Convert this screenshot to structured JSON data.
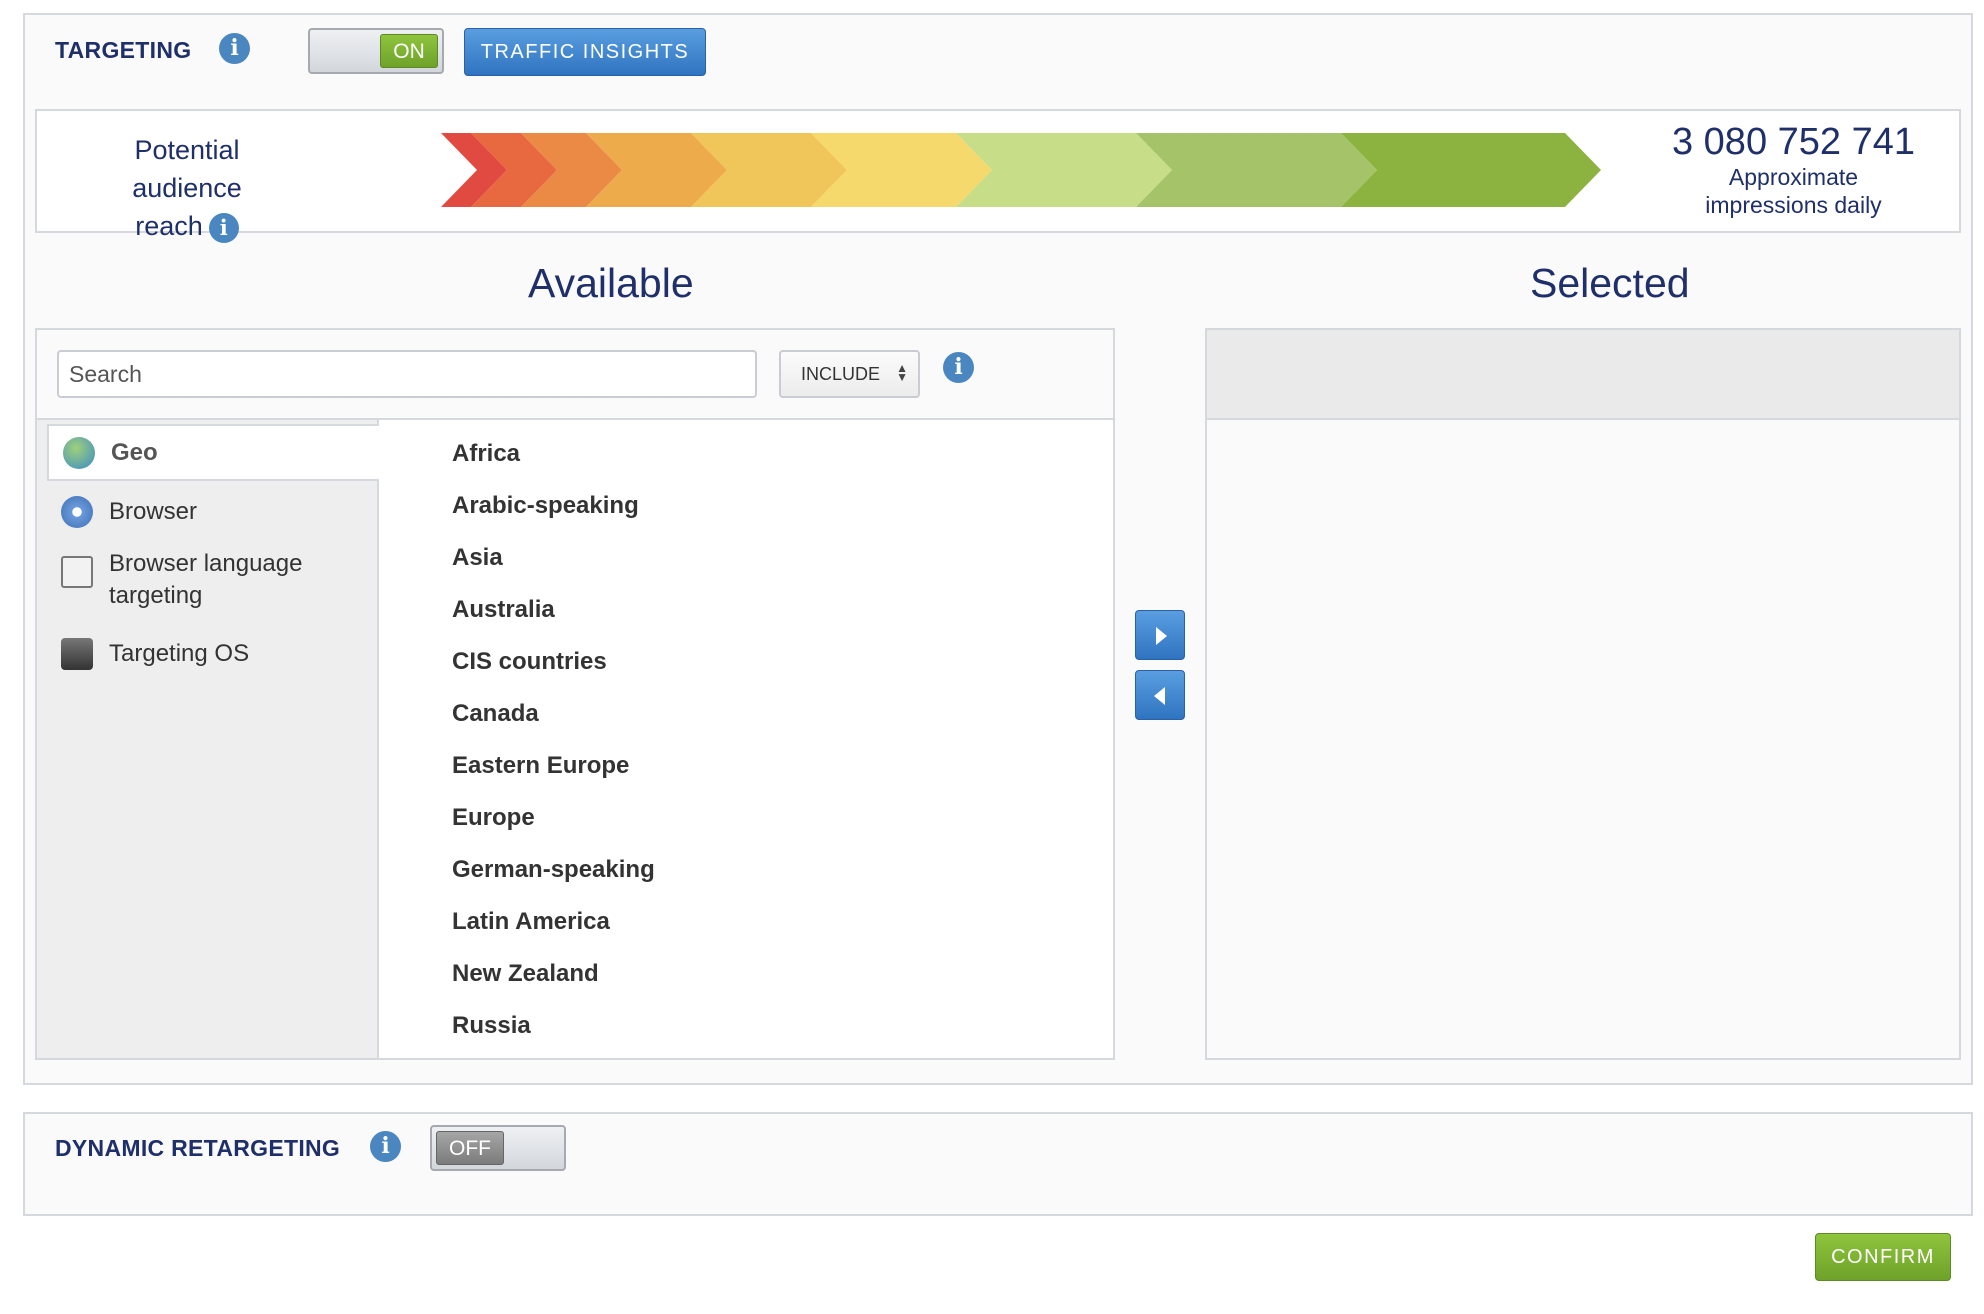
{
  "targeting": {
    "title": "TARGETING",
    "toggle_state": "ON",
    "traffic_insights_label": "TRAFFIC INSIGHTS"
  },
  "reach": {
    "label_line1": "Potential audience",
    "label_line2": "reach",
    "count": "3 080 752 741",
    "caption_line1": "Approximate",
    "caption_line2": "impressions daily"
  },
  "available": {
    "heading": "Available",
    "search_placeholder": "Search",
    "mode_select": "INCLUDE",
    "categories": [
      {
        "label": "Geo",
        "icon": "globe-icon",
        "active": true
      },
      {
        "label": "Browser",
        "icon": "compass-icon",
        "active": false
      },
      {
        "label": "Browser language targeting",
        "icon": "translate-icon",
        "active": false
      },
      {
        "label": "Targeting OS",
        "icon": "os-icon",
        "active": false
      }
    ],
    "regions": [
      "Africa",
      "Arabic-speaking",
      "Asia",
      "Australia",
      "CIS countries",
      "Canada",
      "Eastern Europe",
      "Europe",
      "German-speaking",
      "Latin America",
      "New Zealand",
      "Russia"
    ]
  },
  "selected": {
    "heading": "Selected"
  },
  "retargeting": {
    "title": "DYNAMIC RETARGETING",
    "toggle_state": "OFF"
  },
  "footer": {
    "confirm_label": "CONFIRM"
  },
  "colors": {
    "accent_blue": "#2f74c0",
    "on_green": "#6ea22a",
    "heading_navy": "#1f2f6a"
  }
}
